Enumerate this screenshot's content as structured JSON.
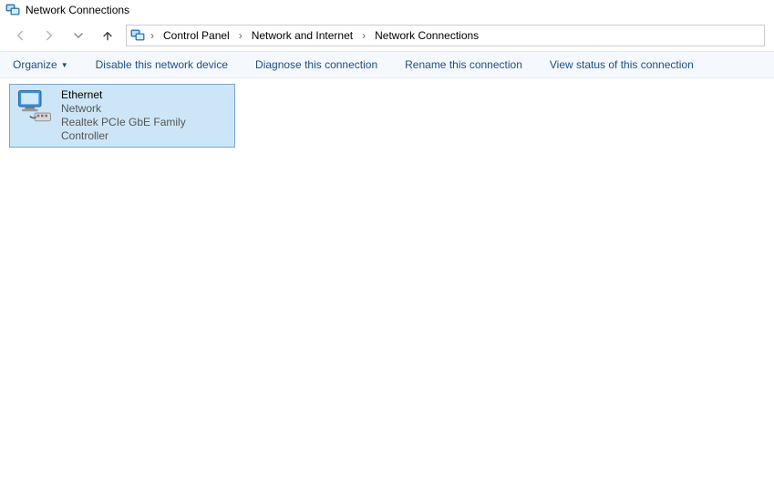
{
  "window": {
    "title": "Network Connections"
  },
  "breadcrumb": {
    "items": [
      "Control Panel",
      "Network and Internet",
      "Network Connections"
    ]
  },
  "toolbar": {
    "organize": "Organize",
    "disable": "Disable this network device",
    "diagnose": "Diagnose this connection",
    "rename": "Rename this connection",
    "viewstatus": "View status of this connection"
  },
  "connections": [
    {
      "name": "Ethernet",
      "status": "Network",
      "device": "Realtek PCIe GbE Family Controller"
    }
  ]
}
